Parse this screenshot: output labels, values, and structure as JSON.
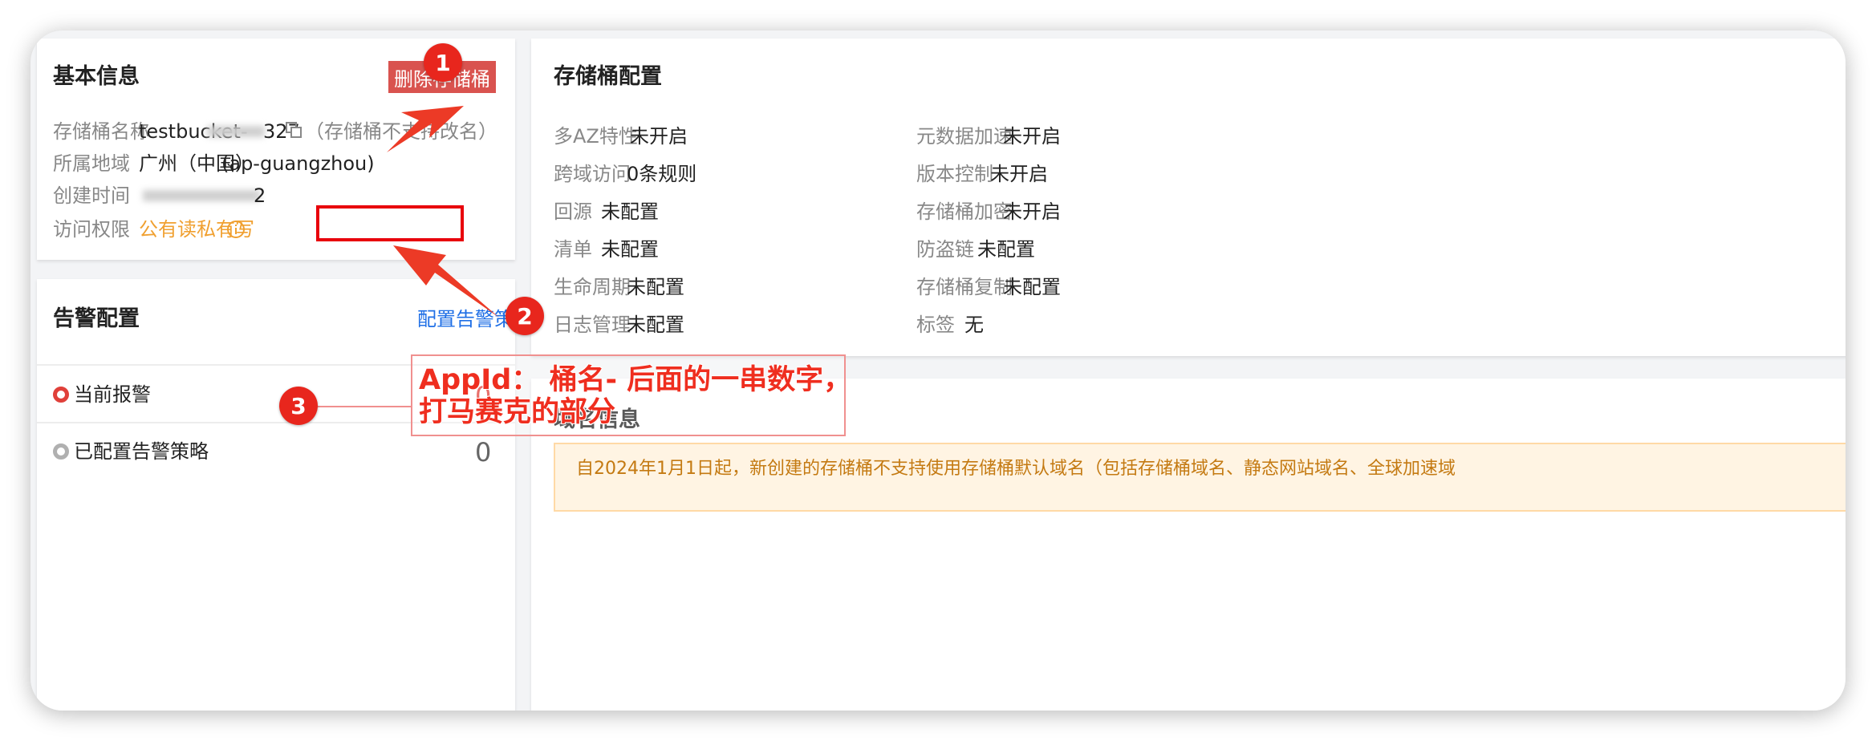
{
  "basic_info": {
    "title": "基本信息",
    "delete_button": "删除存储桶",
    "rows": [
      {
        "label": "存储桶名称",
        "value": "testbucket-",
        "value_tail": "327",
        "note": "（存储桶不支持改名）"
      },
      {
        "label": "所属地域",
        "value": "广州（中国）",
        "region_code": "(ap-guangzhou)"
      },
      {
        "label": "创建时间",
        "value_tail": "2"
      },
      {
        "label": "访问权限",
        "value": "公有读私有写"
      }
    ]
  },
  "alarm": {
    "title": "告警配置",
    "link": "配置告警策略",
    "items": [
      {
        "label": "当前报警",
        "count": "0"
      },
      {
        "label": "已配置告警策略",
        "count": "0"
      }
    ]
  },
  "bucket_config": {
    "title": "存储桶配置",
    "left": [
      {
        "label": "多AZ特性",
        "value": "未开启"
      },
      {
        "label": "跨域访问",
        "value": "0条规则"
      },
      {
        "label": "回源",
        "value": "未配置"
      },
      {
        "label": "清单",
        "value": "未配置"
      },
      {
        "label": "生命周期",
        "value": "未配置"
      },
      {
        "label": "日志管理",
        "value": "未配置"
      }
    ],
    "right": [
      {
        "label": "元数据加速",
        "value": "未开启"
      },
      {
        "label": "版本控制",
        "value": "未开启"
      },
      {
        "label": "存储桶加密",
        "value": "未开启"
      },
      {
        "label": "防盗链",
        "value": "未配置"
      },
      {
        "label": "存储桶复制",
        "value": "未配置"
      },
      {
        "label": "标签",
        "value": "无"
      }
    ]
  },
  "domain_info": {
    "title": "域名信息",
    "notice": "自2024年1月1日起，新创建的存储桶不支持使用存储桶默认域名（包括存储桶域名、静态网站域名、全球加速域"
  },
  "annotations": {
    "markers": [
      "1",
      "2",
      "3"
    ],
    "callout_line1": "AppId： 桶名- 后面的一串数字，",
    "callout_line2": "打马赛克的部分"
  },
  "colors": {
    "danger": "#d9534f",
    "link": "#1f6fe6",
    "warning_text": "#f0a030",
    "alarm_count": "#e0403a",
    "annotation_red": "#e8261d",
    "notice_bg": "#fff4e3"
  },
  "icons": [
    "copy-icon",
    "info-icon",
    "alarm-active-icon",
    "alarm-inactive-icon"
  ]
}
